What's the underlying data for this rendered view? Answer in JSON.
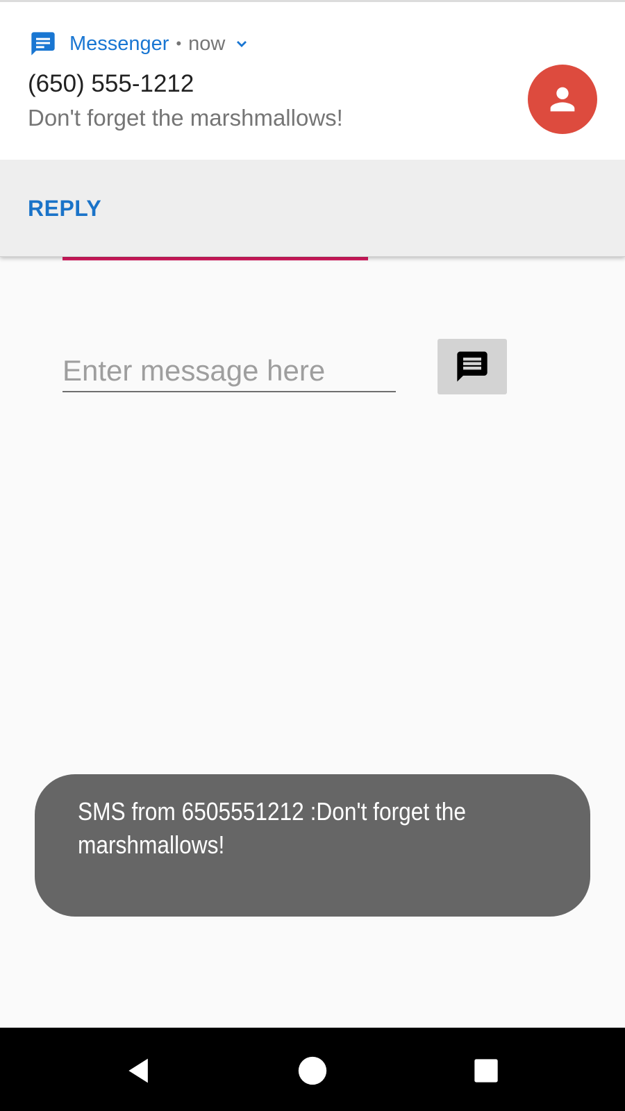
{
  "notification": {
    "app_name": "Messenger",
    "separator": "•",
    "time": "now",
    "sender": "(650) 555-1212",
    "message": "Don't forget the marshmallows!",
    "action_label": "REPLY",
    "app_icon": "messenger-icon",
    "avatar_icon": "person-icon",
    "avatar_color": "#dd4b3e",
    "accent_color": "#1976d2"
  },
  "app": {
    "input_placeholder": "Enter message here",
    "input_value": "",
    "send_icon": "message-icon",
    "accent_line_color": "#d81b60"
  },
  "toast": {
    "text": "SMS from 6505551212 :Don't forget the marshmallows!"
  },
  "nav_bar": {
    "back_icon": "back-triangle-icon",
    "home_icon": "home-circle-icon",
    "recents_icon": "recents-square-icon"
  }
}
